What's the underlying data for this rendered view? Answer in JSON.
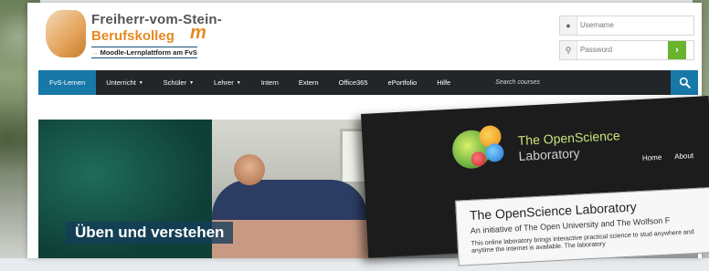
{
  "site": {
    "title": "Freiherr-vom-Stein-",
    "subtitle": "Berufskolleg",
    "logo_mark": "m",
    "tagline_arrow": "→",
    "tagline": "Moodle-Lernplattform am FvS"
  },
  "login": {
    "username_placeholder": "Username",
    "password_placeholder": "Password",
    "submit_icon": "›",
    "user_icon": "user-icon",
    "key_icon": "key-icon",
    "accent": "#6ab42d"
  },
  "nav": {
    "items": [
      {
        "label": "FvS-Lernen",
        "caret": ""
      },
      {
        "label": "Unterricht",
        "caret": "▼"
      },
      {
        "label": "Schüler",
        "caret": "▼"
      },
      {
        "label": "Lehrer",
        "caret": "▼"
      },
      {
        "label": "Intern",
        "caret": ""
      },
      {
        "label": "Extern",
        "caret": ""
      },
      {
        "label": "Office365",
        "caret": ""
      },
      {
        "label": "ePortfolio",
        "caret": ""
      },
      {
        "label": "Hilfe",
        "caret": ""
      }
    ],
    "search_placeholder": "Search courses",
    "accent": "#1878a8",
    "bar_color": "#222629"
  },
  "hero": {
    "caption": "Üben und verstehen"
  },
  "openscience": {
    "title_line1": "The OpenScience",
    "title_line2": "Laboratory",
    "nav": [
      "Home",
      "About"
    ],
    "card_title": "The OpenScience Laboratory",
    "card_subtitle": "An initiative of The Open University and The Wolfson F",
    "card_description": "This online laboratory brings interactive practical science to stud anywhere and anytime the internet is available. The laboratory"
  }
}
